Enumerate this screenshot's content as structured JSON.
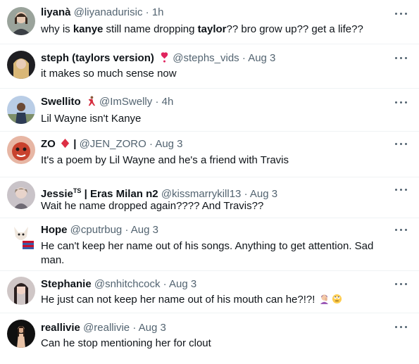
{
  "tweets": [
    {
      "name": "liyanà",
      "handle": "@liyanadurisic",
      "time": "1h",
      "text_parts": [
        "why is ",
        "kanye",
        " still name dropping ",
        "taylor",
        "?? bro grow up?? get a life??"
      ]
    },
    {
      "name": "steph (taylors version)",
      "name_emoji": "heart-exclamation-icon",
      "handle": "@stephs_vids",
      "time": "Aug 3",
      "text": "it makes so much sense now"
    },
    {
      "name": "Swellito",
      "name_emoji": "dancer-icon",
      "handle": "@ImSwelly",
      "time": "4h",
      "text": "Lil Wayne isn't Kanye"
    },
    {
      "name": "ZO",
      "name_suffix": "|",
      "name_emoji": "red-diamond-icon",
      "handle": "@JEN_ZORO",
      "time": "Aug 3",
      "text": "It's a poem by Lil Wayne and he's a friend with Travis"
    },
    {
      "name": "Jessie",
      "name_sup": "TS",
      "name_rest": "| Eras Milan n2",
      "handle": "@kissmarrykill13",
      "time": "Aug 3",
      "text": "Wait he name dropped again???? And Travis??"
    },
    {
      "name": "Hope",
      "handle": "@cputrbug",
      "time": "Aug 3",
      "text": "He can't keep her name out of his songs. Anything to get attention. Sad man."
    },
    {
      "name": "Stephanie",
      "handle": "@snhitchcock",
      "time": "Aug 3",
      "text": "He just can not keep her name out of his mouth can he?!?!",
      "text_emojis": [
        "woman-facepalming-icon",
        "face-with-rolling-eyes-icon"
      ]
    },
    {
      "name": "reallivie",
      "handle": "@reallivie",
      "time": "Aug 3",
      "text": "Can he stop mentioning her for clout"
    }
  ],
  "separator": "·",
  "colors": {
    "text": "#0f1419",
    "secondary": "#536471",
    "divider": "#eff3f4"
  }
}
